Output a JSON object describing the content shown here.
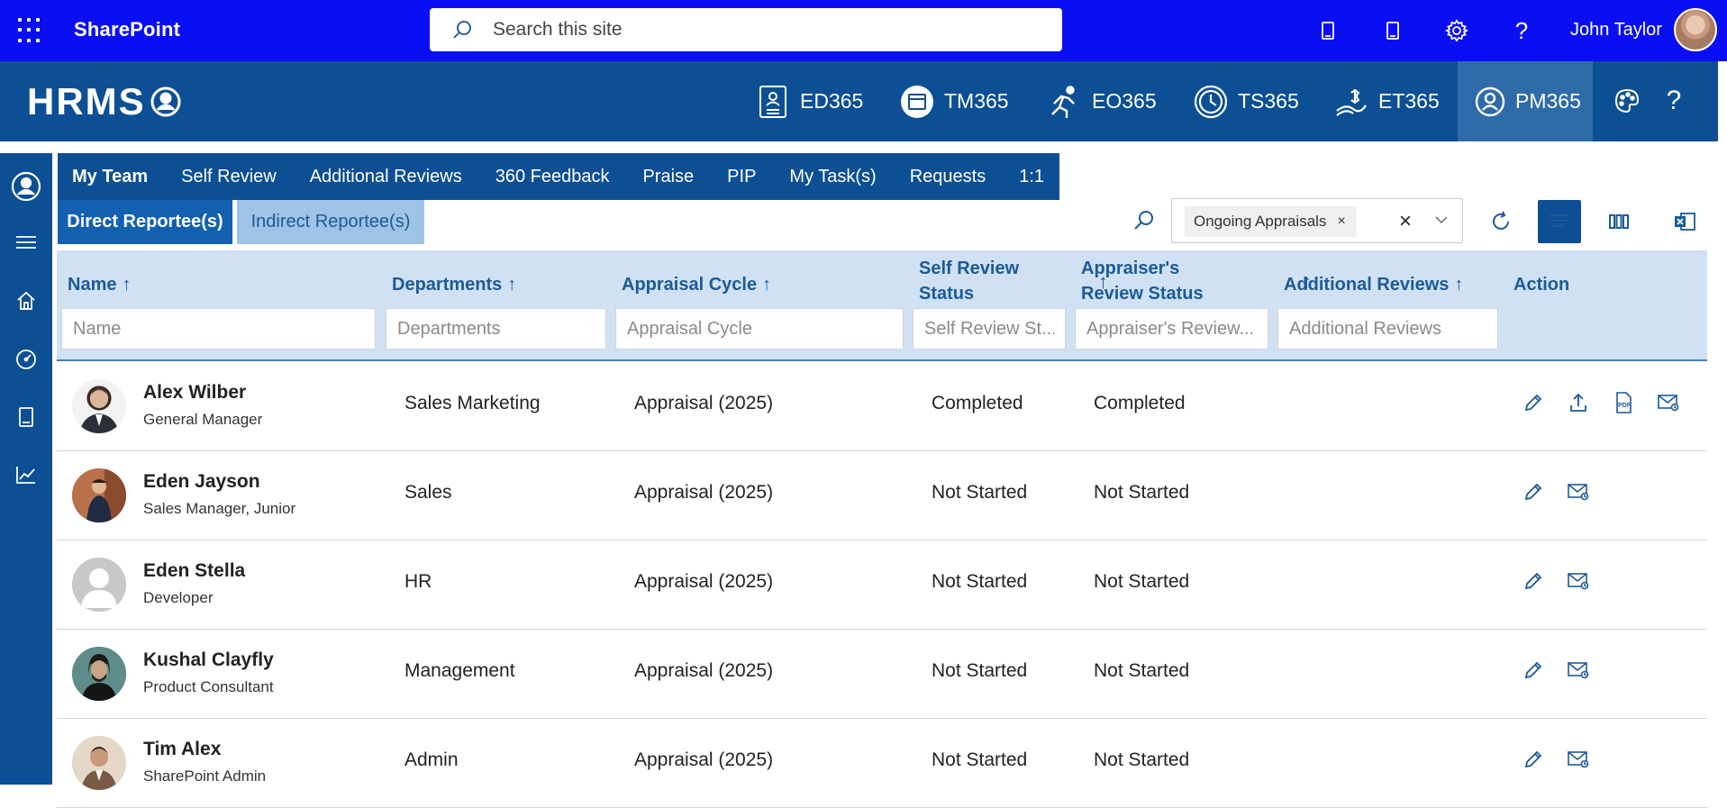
{
  "sharepoint": {
    "app_name": "SharePoint",
    "search_placeholder": "Search this site",
    "user_name": "John Taylor"
  },
  "hrms": {
    "logo_text": "HRMS",
    "modules": [
      {
        "label": "ED365",
        "icon": "employee-directory-icon"
      },
      {
        "label": "TM365",
        "icon": "calendar-icon"
      },
      {
        "label": "EO365",
        "icon": "onboarding-runner-icon"
      },
      {
        "label": "TS365",
        "icon": "clock-icon"
      },
      {
        "label": "ET365",
        "icon": "expense-icon"
      },
      {
        "label": "PM365",
        "icon": "performance-icon",
        "active": true
      }
    ]
  },
  "tabs": {
    "main": [
      "My Team",
      "Self Review",
      "Additional Reviews",
      "360 Feedback",
      "Praise",
      "PIP",
      "My Task(s)",
      "Requests",
      "1:1"
    ],
    "active_main": "My Team",
    "sub": [
      "Direct Reportee(s)",
      "Indirect Reportee(s)"
    ],
    "active_sub": "Direct Reportee(s)"
  },
  "toolbar": {
    "filter_chip": "Ongoing Appraisals",
    "chip_remove": "×",
    "clear": "×"
  },
  "table": {
    "columns": [
      {
        "label": "Name",
        "filter_placeholder": "Name"
      },
      {
        "label": "Departments",
        "filter_placeholder": "Departments"
      },
      {
        "label": "Appraisal Cycle",
        "filter_placeholder": "Appraisal Cycle"
      },
      {
        "label_line1": "Self Review",
        "label_line2": "Status",
        "filter_placeholder": "Self Review St..."
      },
      {
        "label_line1": "Appraiser's",
        "label_line2": "Review Status",
        "filter_placeholder": "Appraiser's Review..."
      },
      {
        "label": "Additional Reviews",
        "filter_placeholder": "Additional Reviews"
      },
      {
        "label": "Action"
      }
    ],
    "sort_arrow": "↑",
    "rows": [
      {
        "name": "Alex Wilber",
        "title": "General Manager",
        "department": "Sales Marketing",
        "cycle": "Appraisal (2025)",
        "self_status": "Completed",
        "appraiser_status": "Completed",
        "actions": [
          "edit-icon",
          "upload-icon",
          "pdf-icon",
          "mail-icon"
        ]
      },
      {
        "name": "Eden Jayson",
        "title": "Sales Manager, Junior",
        "department": "Sales",
        "cycle": "Appraisal (2025)",
        "self_status": "Not Started",
        "appraiser_status": "Not Started",
        "actions": [
          "edit-icon",
          "mail-icon"
        ]
      },
      {
        "name": "Eden Stella",
        "title": "Developer",
        "department": "HR",
        "cycle": "Appraisal (2025)",
        "self_status": "Not Started",
        "appraiser_status": "Not Started",
        "actions": [
          "edit-icon",
          "mail-icon"
        ]
      },
      {
        "name": "Kushal Clayfly",
        "title": "Product Consultant",
        "department": "Management",
        "cycle": "Appraisal (2025)",
        "self_status": "Not Started",
        "appraiser_status": "Not Started",
        "actions": [
          "edit-icon",
          "mail-icon"
        ]
      },
      {
        "name": "Tim Alex",
        "title": "SharePoint Admin",
        "department": "Admin",
        "cycle": "Appraisal (2025)",
        "self_status": "Not Started",
        "appraiser_status": "Not Started",
        "actions": [
          "edit-icon",
          "mail-icon"
        ]
      }
    ]
  },
  "colors": {
    "sharepoint_bar": "#0a0ef2",
    "hrms_bar": "#0d4f94",
    "header_bg": "#cfe1f3",
    "accent_text": "#1d5a96"
  }
}
